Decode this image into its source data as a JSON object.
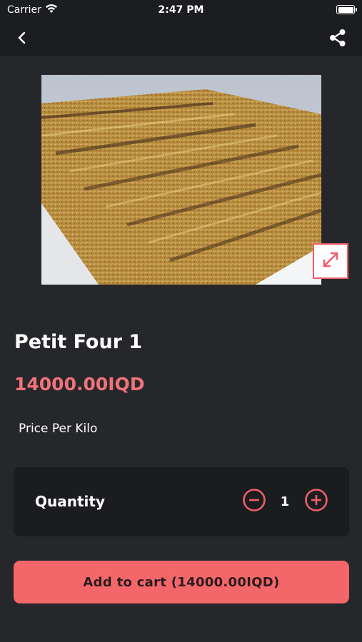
{
  "status_bar": {
    "carrier": "Carrier",
    "time": "2:47 PM",
    "battery_level": 1.0
  },
  "nav": {
    "back_icon": "chevron-left-icon",
    "share_icon": "share-icon"
  },
  "product": {
    "image_alt": "Petit Four 1",
    "expand_icon": "expand-arrows-icon",
    "title": "Petit Four 1",
    "price": "14000.00IQD",
    "price_note": "Price Per Kilo"
  },
  "quantity": {
    "label": "Quantity",
    "value": "1",
    "decrement_icon": "minus-circle-icon",
    "increment_icon": "plus-circle-icon"
  },
  "cart": {
    "button_label": "Add to cart (14000.00IQD)"
  },
  "colors": {
    "accent": "#f0727b",
    "button": "#f3676a",
    "background": "#26272b",
    "card": "#1b1c1f"
  }
}
